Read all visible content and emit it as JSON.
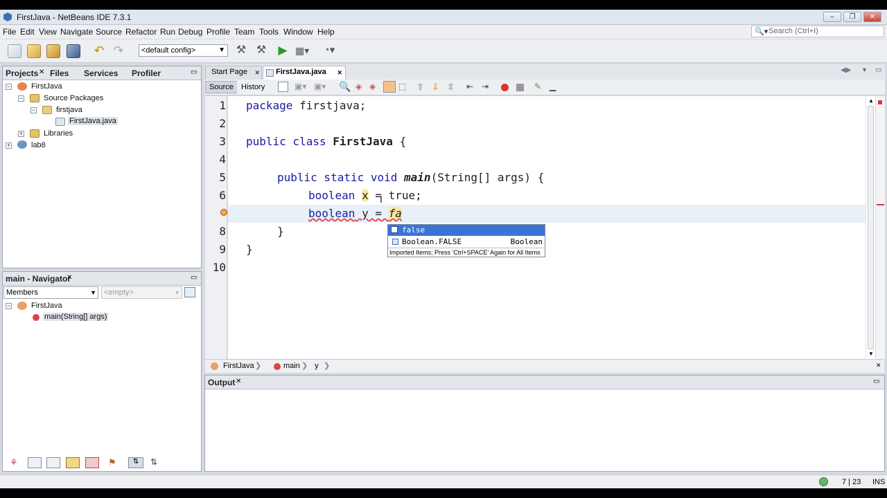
{
  "window": {
    "title": "FirstJava - NetBeans IDE 7.3.1"
  },
  "menu": [
    "File",
    "Edit",
    "View",
    "Navigate",
    "Source",
    "Refactor",
    "Run",
    "Debug",
    "Profile",
    "Team",
    "Tools",
    "Window",
    "Help"
  ],
  "search": {
    "placeholder": "Search (Ctrl+I)"
  },
  "toolbar": {
    "config": "<default config>"
  },
  "projects_panel": {
    "tabs": [
      "Projects",
      "Files",
      "Services",
      "Profiler"
    ],
    "tree": {
      "project": "FirstJava",
      "source_packages": "Source Packages",
      "package": "firstjava",
      "file": "FirstJava.java",
      "libraries": "Libraries",
      "other_project": "lab8"
    }
  },
  "navigator": {
    "title": "main - Navigator",
    "filter": "Members",
    "empty": "<empty>",
    "class": "FirstJava",
    "method": "main(String[] args)"
  },
  "editor": {
    "tabs": [
      "Start Page",
      "FirstJava.java"
    ],
    "source_label": "Source",
    "history_label": "History",
    "line_numbers": [
      "1",
      "2",
      "3",
      "4",
      "5",
      "6",
      "7",
      "8",
      "9",
      "10"
    ],
    "code": {
      "l1_kw": "package",
      "l1_rest": " firstjava;",
      "l3_kw": "public class",
      "l3_cls": "FirstJava",
      "l3_rest": " {",
      "l5_kw": "public static void",
      "l5_m": "main",
      "l5_rest": "(String[] args) {",
      "l6_kw": "boolean",
      "l6_var": "x",
      "l6_rest": " = true;",
      "l7_kw": "boolean",
      "l7_rest": " y = ",
      "l7_typed": "fa",
      "l8": "}",
      "l9": "}"
    },
    "completion": {
      "item1": "false",
      "item2": "Boolean.FALSE",
      "item2_type": "Boolean",
      "hint": "Imported Items; Press 'Ctrl+SPACE' Again for All Items"
    },
    "breadcrumbs": [
      "FirstJava",
      "main",
      "y"
    ]
  },
  "output": {
    "title": "Output"
  },
  "status": {
    "position": "7 | 23",
    "mode": "INS"
  }
}
